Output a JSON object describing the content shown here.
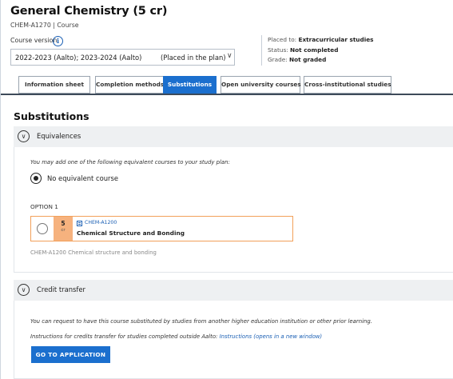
{
  "header": {
    "title": "General Chemistry (5 cr)",
    "code_line": "CHEM-A1270 | Course"
  },
  "course_version": {
    "label": "Course version",
    "info_icon": "i",
    "value": "2022-2023 (Aalto); 2023-2024 (Aalto)",
    "annotation": "(Placed in the plan)",
    "chevron": "∨"
  },
  "status_panel": {
    "placed_label": "Placed to:",
    "placed_value": "Extracurricular studies",
    "status_label": "Status:",
    "status_value": "Not completed",
    "grade_label": "Grade:",
    "grade_value": "Not graded"
  },
  "tabs": [
    {
      "label": "Information sheet",
      "active": false
    },
    {
      "label": "Completion methods",
      "active": false
    },
    {
      "label": "Substitutions",
      "active": true
    },
    {
      "label": "Open university courses",
      "active": false
    },
    {
      "label": "Cross-institutional studies",
      "active": false
    }
  ],
  "substitutions": {
    "title": "Substitutions",
    "equivalences": {
      "heading": "Equivalences",
      "toggle_icon": "∨",
      "hint": "You may add one of the following equivalent courses to your study plan:",
      "no_equivalent_label": "No equivalent course",
      "option_label": "OPTION 1",
      "option": {
        "credits": "5",
        "credits_unit": "cr",
        "code": "CHEM-A1200",
        "name": "Chemical Structure and Bonding"
      },
      "footnote": "CHEM-A1200 Chemical structure and bonding"
    },
    "credit_transfer": {
      "heading": "Credit transfer",
      "toggle_icon": "∨",
      "text": "You can request to have this course substituted by studies from another higher education institution or other prior learning.",
      "instructions_prefix": "Instructions for credits transfer for studies completed outside Aalto:",
      "instructions_link": "Instructions (opens in a new window)",
      "button_label": "GO TO APPLICATION"
    }
  },
  "colors": {
    "accent": "#1b6fce",
    "option_border": "#f2a05a",
    "credits_fill": "#f6b27e",
    "accordion_bg": "#eef0f2"
  }
}
